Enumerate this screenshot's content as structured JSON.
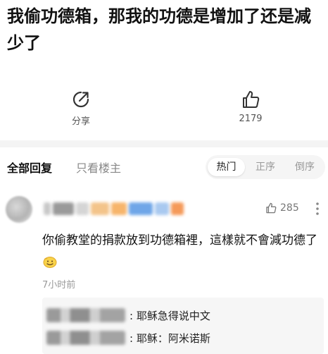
{
  "post": {
    "title": "我偷功德箱，那我的功德是增加了还是减少了"
  },
  "actions": {
    "share_label": "分享",
    "like_count": "2179"
  },
  "tabs": {
    "all_replies": "全部回复",
    "only_op": "只看楼主",
    "sort_hot": "热门",
    "sort_asc": "正序",
    "sort_desc": "倒序"
  },
  "comment": {
    "like_count": "285",
    "text": "你偷教堂的捐款放到功德箱裡，這樣就不會減功德了",
    "time": "7小时前",
    "replies": [
      {
        "text": ": 耶稣急得说中文"
      },
      {
        "text": ": 耶稣：阿米诺斯"
      }
    ]
  },
  "icons": {
    "share": "share-icon",
    "like": "thumbs-up-icon",
    "more": "more-vertical-icon",
    "emoji": "grinning-face-emoji"
  }
}
